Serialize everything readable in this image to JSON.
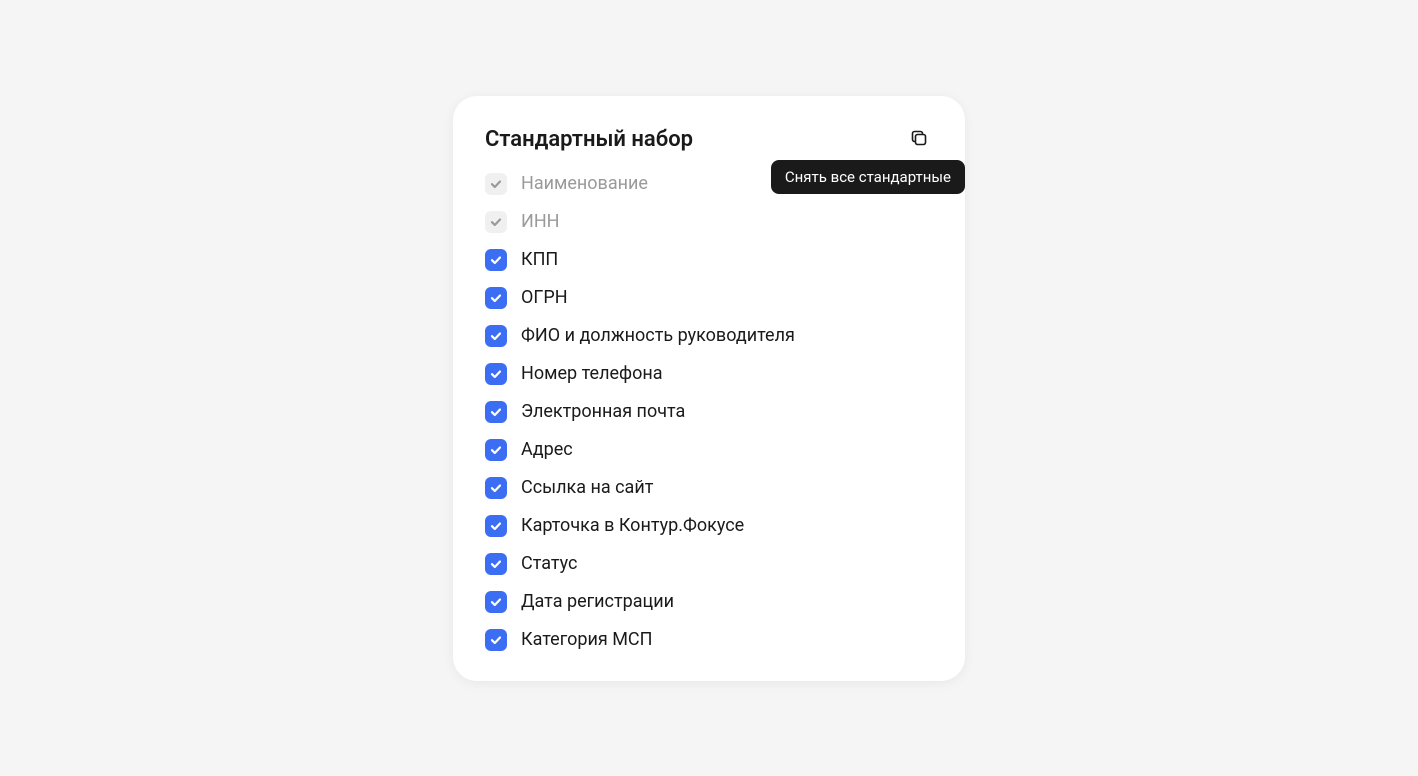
{
  "card": {
    "title": "Стандартный набор",
    "tooltip": "Снять все стандартные",
    "items": [
      {
        "label": "Наименование",
        "checked": true,
        "disabled": true
      },
      {
        "label": "ИНН",
        "checked": true,
        "disabled": true
      },
      {
        "label": "КПП",
        "checked": true,
        "disabled": false
      },
      {
        "label": "ОГРН",
        "checked": true,
        "disabled": false
      },
      {
        "label": "ФИО и должность руководителя",
        "checked": true,
        "disabled": false
      },
      {
        "label": "Номер телефона",
        "checked": true,
        "disabled": false
      },
      {
        "label": "Электронная почта",
        "checked": true,
        "disabled": false
      },
      {
        "label": "Адрес",
        "checked": true,
        "disabled": false
      },
      {
        "label": "Ссылка на сайт",
        "checked": true,
        "disabled": false
      },
      {
        "label": "Карточка в Контур.Фокусе",
        "checked": true,
        "disabled": false
      },
      {
        "label": "Статус",
        "checked": true,
        "disabled": false
      },
      {
        "label": "Дата регистрации",
        "checked": true,
        "disabled": false
      },
      {
        "label": "Категория МСП",
        "checked": true,
        "disabled": false
      }
    ]
  }
}
